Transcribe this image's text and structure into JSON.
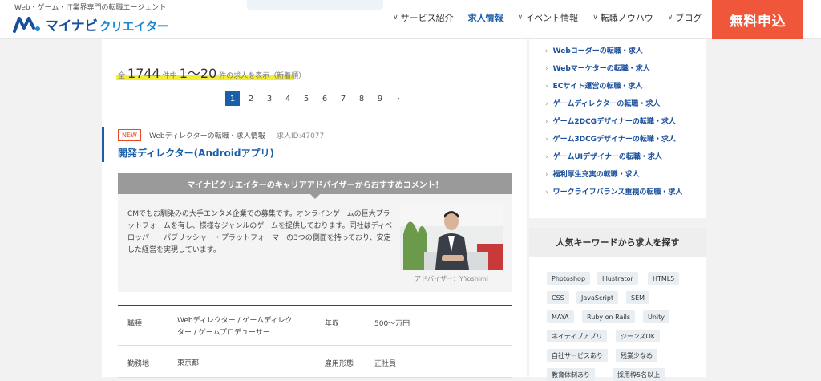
{
  "header": {
    "tagline": "Web・ゲーム・IT業界専門の転職エージェント",
    "logo_main": "マイナビ",
    "logo_sub": "クリエイター",
    "nav": [
      {
        "label": "サービス紹介",
        "active": false
      },
      {
        "label": "求人情報",
        "active": true
      },
      {
        "label": "イベント情報",
        "active": false
      },
      {
        "label": "転職ノウハウ",
        "active": false
      },
      {
        "label": "ブログ",
        "active": false
      }
    ],
    "cta": "無料申込"
  },
  "results": {
    "prefix": "全",
    "total": "1744",
    "mid": "件中",
    "range": "1〜20",
    "suffix": "件の求人を表示（新着順）"
  },
  "pagination": [
    "1",
    "2",
    "3",
    "4",
    "5",
    "6",
    "7",
    "8",
    "9",
    "›"
  ],
  "job": {
    "badge": "NEW",
    "category": "Webディレクターの転職・求人情報",
    "id": "求人ID:47077",
    "title": "開発ディレクター(Androidアプリ)",
    "advisor_heading": "マイナビクリエイターのキャリアアドバイザーからおすすめコメント！",
    "advisor_text": "CMでもお馴染みの大手エンタメ企業での募集です。オンラインゲームの巨大プラットフォームを有し、様様なジャンルのゲームを提供しております。同社はディベロッパー・パブリッシャー・プラットフォーマーの3つの側面を持っており、安定した経営を実現しています。",
    "advisor_caption": "アドバイザー：Y.Yoshimi",
    "table": [
      {
        "k1": "職種",
        "v1a": "Webディレクター / ゲームディレク",
        "v1b": "ター / ゲームプロデューサー",
        "k2": "年収",
        "v2": "500〜万円"
      },
      {
        "k1": "勤務地",
        "v1a": "東京都",
        "v1b": "",
        "k2": "雇用形態",
        "v2": "正社員"
      }
    ]
  },
  "sidebar": {
    "links": [
      "Webコーダーの転職・求人",
      "Webマーケターの転職・求人",
      "ECサイト運営の転職・求人",
      "ゲームディレクターの転職・求人",
      "ゲーム2DCGデザイナーの転職・求人",
      "ゲーム3DCGデザイナーの転職・求人",
      "ゲームUIデザイナーの転職・求人",
      "福利厚生充実の転職・求人",
      "ワークライフバランス重視の転職・求人"
    ],
    "keyword_heading": "人気キーワードから求人を探す",
    "keywords": [
      "Photoshop",
      "Illustrator",
      "HTML5",
      "CSS",
      "JavaScript",
      "SEM",
      "MAYA",
      "Ruby on Rails",
      "Unity",
      "ネイティブアプリ",
      "ジーンズOK",
      "自社サービスあり",
      "残業少なめ",
      "教育体制あり",
      "採用枠5名以上"
    ]
  },
  "colors": {
    "brand_blue": "#1a5fa8",
    "cta_orange": "#f0573a",
    "highlight": "#f4ee33",
    "new_badge": "#e84a27"
  }
}
